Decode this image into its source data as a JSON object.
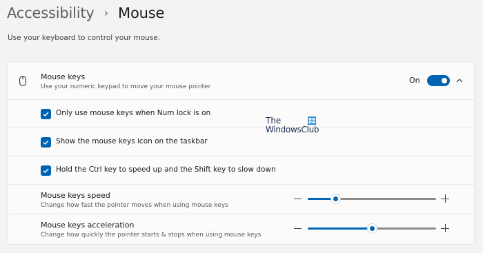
{
  "breadcrumb": {
    "parent": "Accessibility",
    "separator": "›",
    "current": "Mouse"
  },
  "page": {
    "subtitle": "Use your keyboard to control your mouse."
  },
  "mouse_keys": {
    "icon": "mouse-icon",
    "title": "Mouse keys",
    "description": "Use your numeric keypad to move your mouse pointer",
    "toggle_status": "On",
    "toggle_on": true,
    "expanded": true
  },
  "options": [
    {
      "label": "Only use mouse keys when Num lock is on",
      "checked": true
    },
    {
      "label": "Show the mouse keys icon on the taskbar",
      "checked": true
    },
    {
      "label": "Hold the Ctrl key to speed up and the Shift key to slow down",
      "checked": true
    }
  ],
  "sliders": [
    {
      "title": "Mouse keys speed",
      "description": "Change how fast the pointer moves when using mouse keys",
      "value_percent": 22
    },
    {
      "title": "Mouse keys acceleration",
      "description": "Change how quickly the pointer starts & stops when using mouse keys",
      "value_percent": 50
    }
  ],
  "watermark": {
    "line1": "The",
    "line2": "WindowsClub"
  },
  "colors": {
    "accent": "#0063b1",
    "page_background": "#f3f3f3",
    "card_background": "#fbfbfb"
  }
}
